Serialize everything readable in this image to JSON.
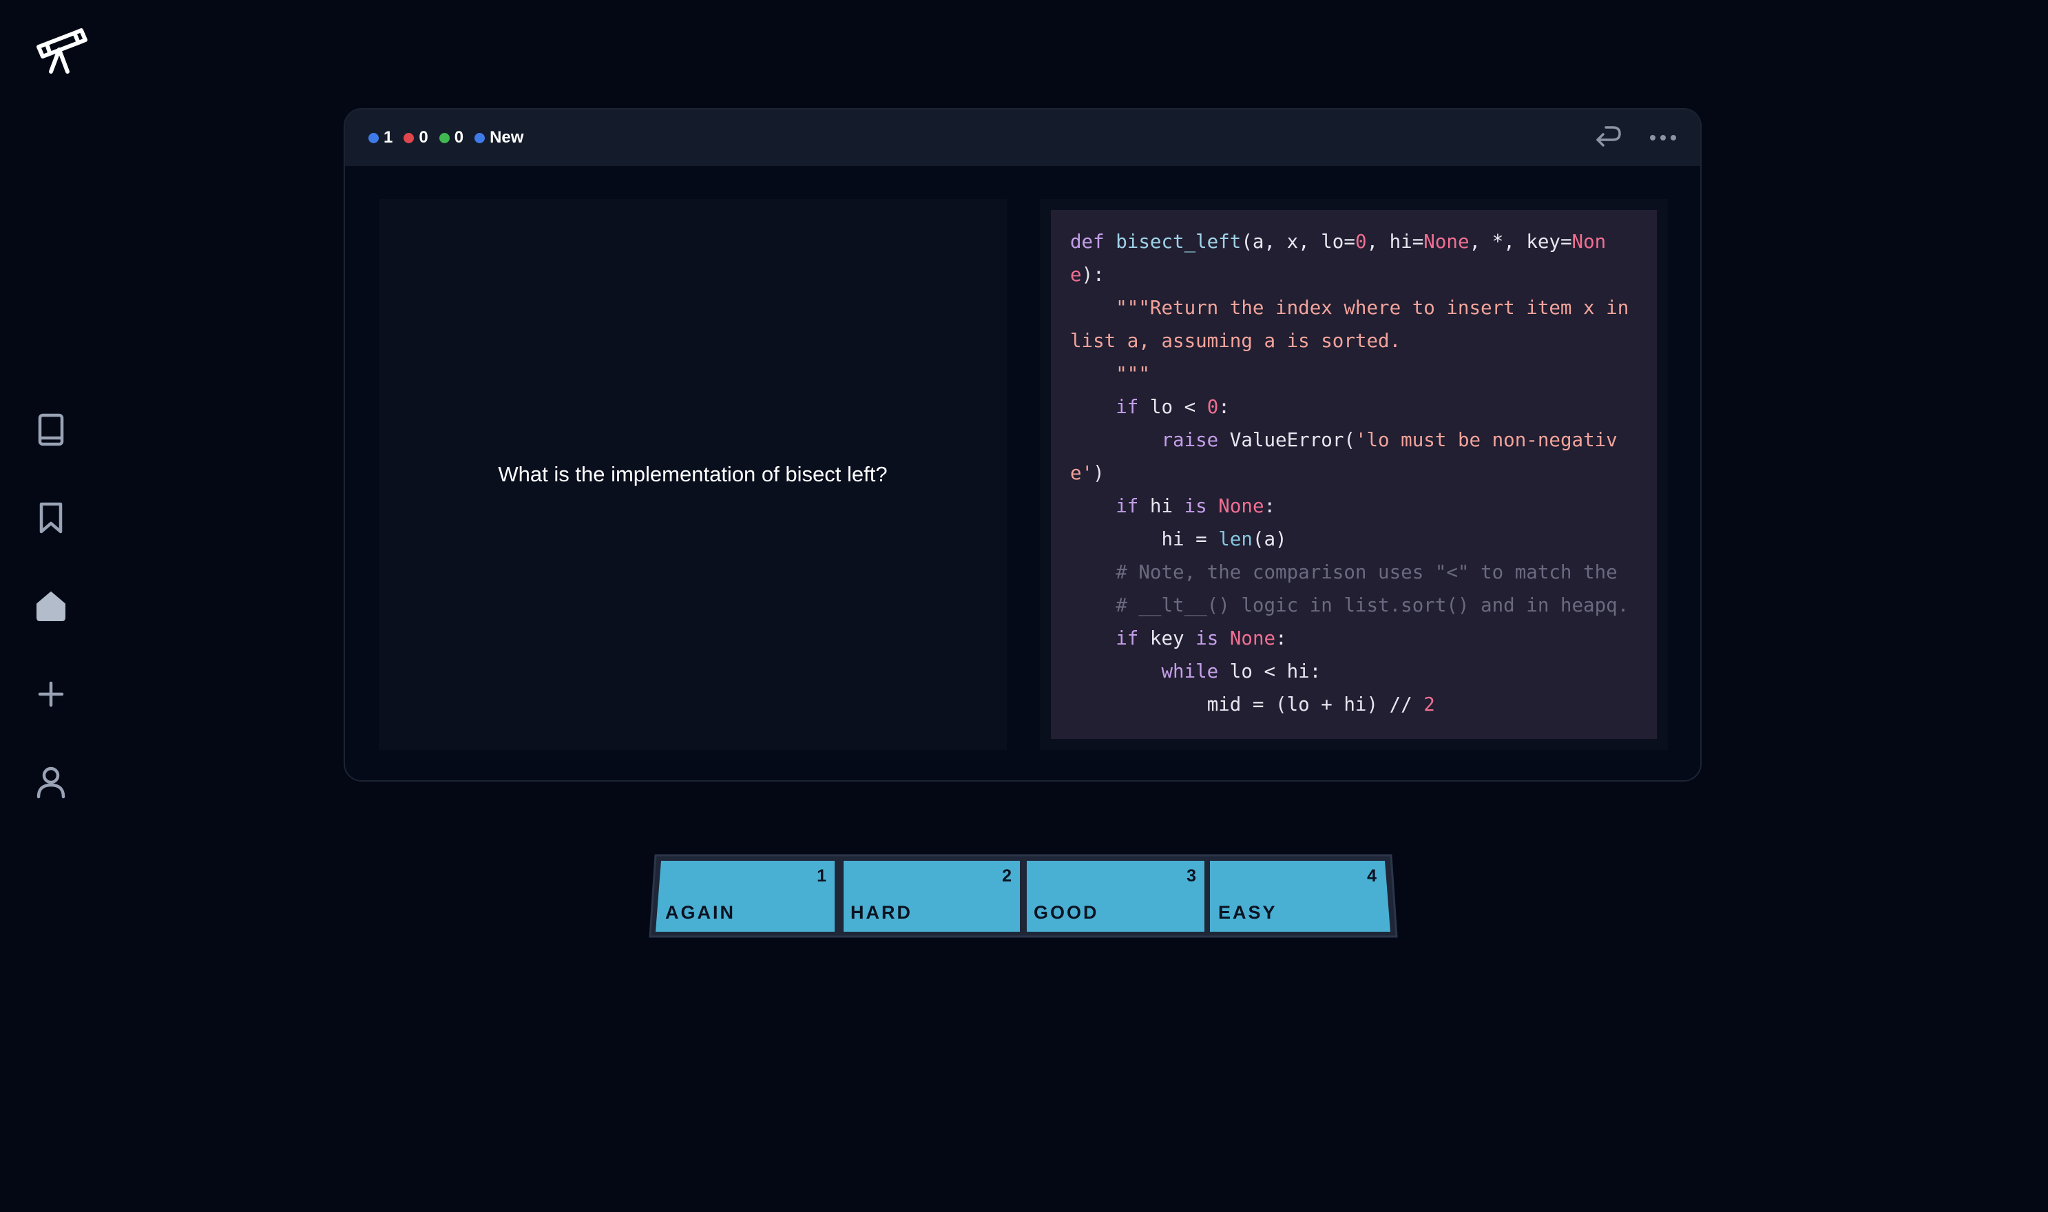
{
  "colors": {
    "background": "#040815",
    "header": "#141b2a",
    "pane": "#0a0f1e",
    "code_bg": "#211f31",
    "button_fill": "#4ab0d3",
    "new_dot": "#3f7be8",
    "learning_dot": "#e0474c",
    "review_dot": "#3fb950"
  },
  "sidebar": {
    "logo_icon": "telescope-icon",
    "items": [
      {
        "icon": "book-icon"
      },
      {
        "icon": "bookmark-icon"
      },
      {
        "icon": "home-icon"
      },
      {
        "icon": "plus-icon"
      },
      {
        "icon": "user-icon"
      }
    ]
  },
  "card": {
    "counts": {
      "new": "1",
      "learning": "0",
      "review": "0",
      "state_label": "New"
    },
    "header_icons": [
      "undo-icon",
      "more-icon"
    ],
    "question": "What is the implementation of bisect left?",
    "answer_code": "def bisect_left(a, x, lo=0, hi=None, *, key=None):\n    \"\"\"Return the index where to insert item x in list a, assuming a is sorted.\n    \"\"\"\n    if lo < 0:\n        raise ValueError('lo must be non-negative')\n    if hi is None:\n        hi = len(a)\n    # Note, the comparison uses \"<\" to match the\n    # __lt__() logic in list.sort() and in heapq.\n    if key is None:\n        while lo < hi:\n            mid = (lo + hi) // 2"
  },
  "answers": [
    {
      "key": "1",
      "label": "AGAIN"
    },
    {
      "key": "2",
      "label": "HARD"
    },
    {
      "key": "3",
      "label": "GOOD"
    },
    {
      "key": "4",
      "label": "EASY"
    }
  ]
}
